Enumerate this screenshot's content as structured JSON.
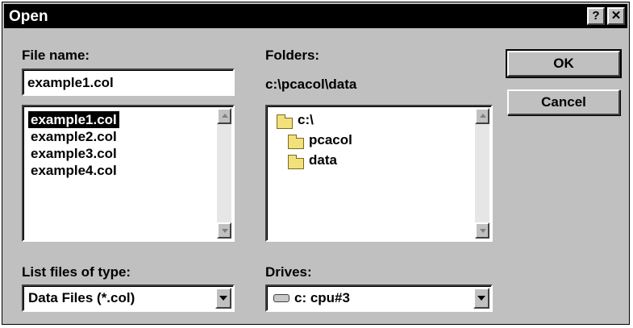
{
  "window": {
    "title": "Open",
    "help_label": "?",
    "close_label": "✕"
  },
  "file_name": {
    "label": "File name:",
    "value": "example1.col",
    "files": [
      {
        "name": "example1.col",
        "selected": true
      },
      {
        "name": "example2.col",
        "selected": false
      },
      {
        "name": "example3.col",
        "selected": false
      },
      {
        "name": "example4.col",
        "selected": false
      }
    ]
  },
  "folders": {
    "label": "Folders:",
    "current_path": "c:\\pcacol\\data",
    "tree": [
      {
        "name": "c:\\",
        "icon": "open-folder-icon"
      },
      {
        "name": "pcacol",
        "icon": "open-folder-icon"
      },
      {
        "name": "data",
        "icon": "folder-icon"
      }
    ]
  },
  "buttons": {
    "ok": "OK",
    "cancel": "Cancel"
  },
  "file_type": {
    "label": "List files of type:",
    "value": "Data Files (*.col)"
  },
  "drives": {
    "label": "Drives:",
    "value": "c: cpu#3",
    "icon": "drive-icon"
  }
}
